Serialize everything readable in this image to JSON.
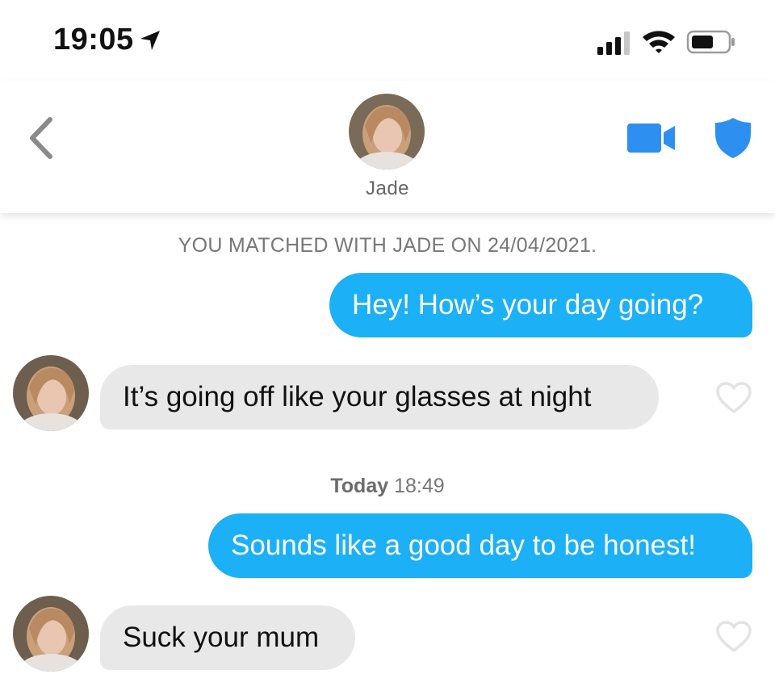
{
  "status_bar": {
    "time": "19:05",
    "icons": [
      "location-arrow-icon",
      "signal-icon",
      "wifi-icon",
      "battery-icon"
    ]
  },
  "header": {
    "back_icon": "chevron-left-icon",
    "name": "Jade",
    "video_icon": "video-camera-icon",
    "safety_icon": "shield-icon"
  },
  "chat": {
    "match_note": "YOU MATCHED WITH JADE ON 24/04/2021.",
    "separator": {
      "day": "Today",
      "time": "18:49"
    },
    "messages": [
      {
        "direction": "outgoing",
        "text": "Hey! How’s your day going?"
      },
      {
        "direction": "incoming",
        "text": "It’s going off like your glasses at night"
      },
      {
        "direction": "outgoing",
        "text": "Sounds like a good day to be honest!"
      },
      {
        "direction": "incoming",
        "text": "Suck your mum"
      }
    ]
  },
  "colors": {
    "outgoing_bubble": "#1cb0f6",
    "incoming_bubble": "#e8e8e8",
    "accent_icon": "#2d8ff0"
  }
}
